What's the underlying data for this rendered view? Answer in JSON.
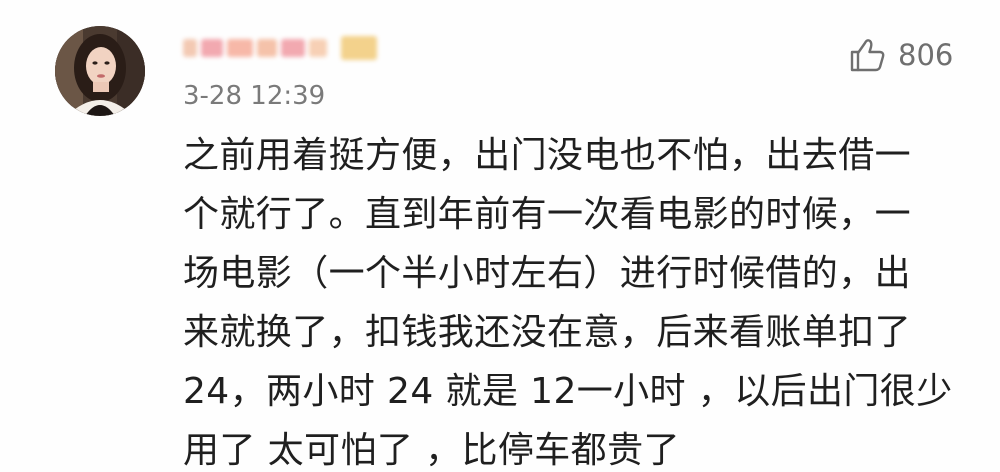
{
  "comment": {
    "author": {
      "name": "",
      "avatar_alt": "avatar"
    },
    "timestamp": "3-28 12:39",
    "like": {
      "icon": "thumbs-up-icon",
      "count": "806"
    },
    "lines": [
      "之前用着挺方便，出门没电也不怕，出去借一",
      "个就行了。直到年前有一次看电影的时候，一",
      "场电影（一个半小时左右）进行时候借的，出",
      "来就换了，扣钱我还没在意，后来看账单扣了",
      "24，两小时 24 就是 12一小时 ，以后出门很少",
      "用了 太可怕了 ，比停车都贵了"
    ]
  },
  "colors": {
    "text": "#1f1f1f",
    "meta": "#7a7a7a",
    "like": "#6f6f6f",
    "blur_pink": "#f2a9b0",
    "blur_peach": "#f7c9a8",
    "blur_gold": "#f3d28c"
  }
}
